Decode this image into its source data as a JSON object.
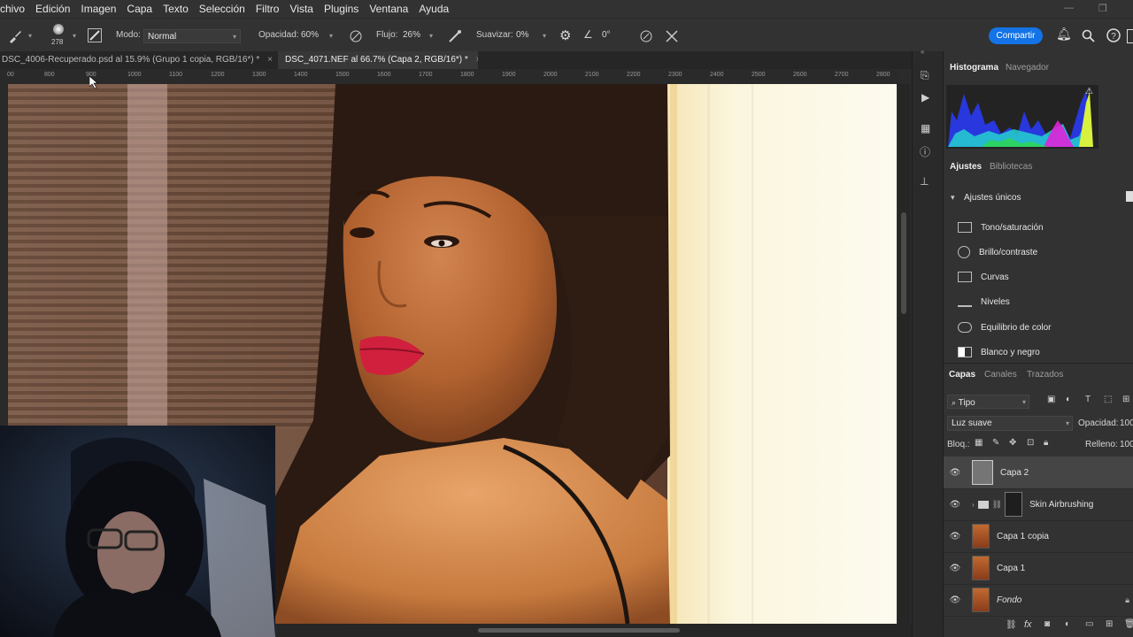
{
  "menu": [
    "chivo",
    "Edición",
    "Imagen",
    "Capa",
    "Texto",
    "Selección",
    "Filtro",
    "Vista",
    "Plugins",
    "Ventana",
    "Ayuda"
  ],
  "options": {
    "brush_size": "278",
    "mode_label": "Modo:",
    "mode_value": "Normal",
    "opacity_label": "Opacidad:",
    "opacity_value": "60%",
    "flow_label": "Flujo:",
    "flow_value": "26%",
    "smooth_label": "Suavizar:",
    "smooth_value": "0%",
    "angle_value": "0°",
    "share_label": "Compartir"
  },
  "tabs": [
    {
      "label": "DSC_4006-Recuperado.psd al 15.9% (Grupo 1 copia, RGB/16*) *",
      "close": "×"
    },
    {
      "label": "DSC_4071.NEF al 66.7% (Capa 2, RGB/16*) *",
      "close": "×"
    }
  ],
  "ruler": [
    "00",
    "800",
    "900",
    "1000",
    "1100",
    "1200",
    "1300",
    "1400",
    "1500",
    "1600",
    "1700",
    "1800",
    "1900",
    "2000",
    "2100",
    "2200",
    "2300",
    "2400",
    "2500",
    "2600",
    "2700",
    "2800"
  ],
  "panel": {
    "top_tabs": [
      "Histograma",
      "Navegador"
    ],
    "adj_tabs": [
      "Ajustes",
      "Bibliotecas"
    ],
    "section_title": "Ajustes únicos",
    "adjustments": [
      {
        "label": "Tono/saturación",
        "icon": "hue-saturation-icon"
      },
      {
        "label": "Brillo/contraste",
        "icon": "brightness-icon"
      },
      {
        "label": "Curvas",
        "icon": "curves-icon"
      },
      {
        "label": "Niveles",
        "icon": "levels-icon"
      },
      {
        "label": "Equilibrio de color",
        "icon": "color-balance-icon"
      },
      {
        "label": "Blanco y negro",
        "icon": "black-white-icon"
      }
    ],
    "layer_tabs": [
      "Capas",
      "Canales",
      "Trazados"
    ],
    "filter_kind": "Tipo",
    "blend_mode": "Luz suave",
    "opacity_label": "Opacidad:",
    "opacity_value": "100",
    "lock_label": "Bloq.:",
    "fill_label": "Relleno:",
    "fill_value": "100",
    "layers": [
      {
        "name": "Capa 2",
        "selected": true
      },
      {
        "name": "Skin Airbrushing",
        "group": true
      },
      {
        "name": "Capa 1 copia"
      },
      {
        "name": "Capa 1"
      },
      {
        "name": "Fondo",
        "italic": true
      }
    ]
  },
  "colors": {
    "accent": "#1473e6",
    "lips": "#d0203d"
  }
}
